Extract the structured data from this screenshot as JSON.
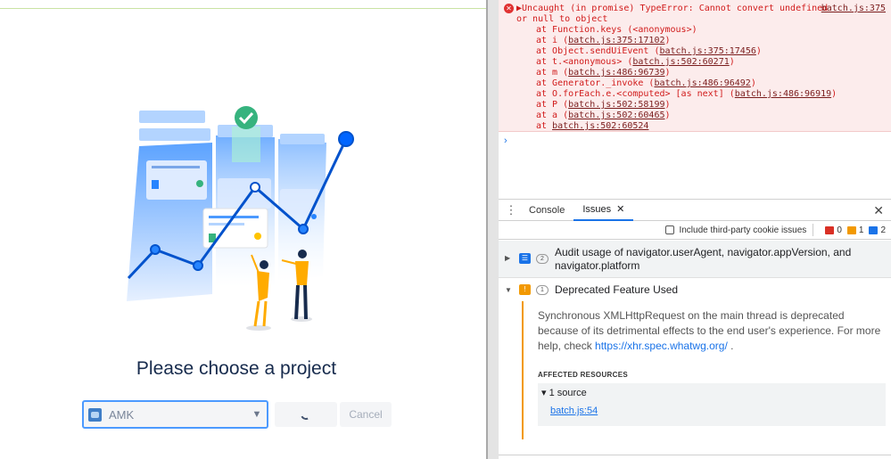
{
  "app": {
    "title": "Please choose a project",
    "select_value": "AMK",
    "cancel_label": "Cancel"
  },
  "console": {
    "error_line1": "▶Uncaught (in promise) TypeError: Cannot convert undefined",
    "error_line2": "or null to object",
    "error_link": "batch.js:375",
    "frames": [
      {
        "prefix": "at Function.keys (<anonymous>)",
        "link": "",
        "suffix": ""
      },
      {
        "prefix": "at i (",
        "link": "batch.js:375:17102",
        "suffix": ")"
      },
      {
        "prefix": "at Object.sendUiEvent (",
        "link": "batch.js:375:17456",
        "suffix": ")"
      },
      {
        "prefix": "at t.<anonymous> (",
        "link": "batch.js:502:60271",
        "suffix": ")"
      },
      {
        "prefix": "at m (",
        "link": "batch.js:486:96739",
        "suffix": ")"
      },
      {
        "prefix": "at Generator._invoke (",
        "link": "batch.js:486:96492",
        "suffix": ")"
      },
      {
        "prefix": "at O.forEach.e.<computed> [as next] (",
        "link": "batch.js:486:96919",
        "suffix": ")"
      },
      {
        "prefix": "at P (",
        "link": "batch.js:502:58199",
        "suffix": ")"
      },
      {
        "prefix": "at a (",
        "link": "batch.js:502:60465",
        "suffix": ")"
      },
      {
        "prefix": "at ",
        "link": "batch.js:502:60524",
        "suffix": ""
      }
    ],
    "prompt": "›"
  },
  "drawer": {
    "tab_console": "Console",
    "tab_issues": "Issues",
    "close": "✕"
  },
  "issues_toolbar": {
    "third_party_label": "Include third-party cookie issues",
    "count_errors": "0",
    "count_warnings": "1",
    "count_info": "2"
  },
  "issues": [
    {
      "title": "Audit usage of navigator.userAgent, navigator.appVersion, and navigator.platform",
      "count": "2"
    },
    {
      "title": "Deprecated Feature Used",
      "count": "1"
    }
  ],
  "issue_detail": {
    "description": "Synchronous XMLHttpRequest on the main thread is deprecated because of its detrimental effects to the end user's experience. For more help, check",
    "help_link": "https://xhr.spec.whatwg.org/",
    "help_suffix": " .",
    "affected_label": "AFFECTED RESOURCES",
    "sources_label": "▾ 1 source",
    "source_link": "batch.js:54"
  },
  "colors": {
    "accent": "#1a73e8",
    "error": "#d11b1b",
    "warning": "#f29900",
    "jira_blue": "#0052cc"
  }
}
